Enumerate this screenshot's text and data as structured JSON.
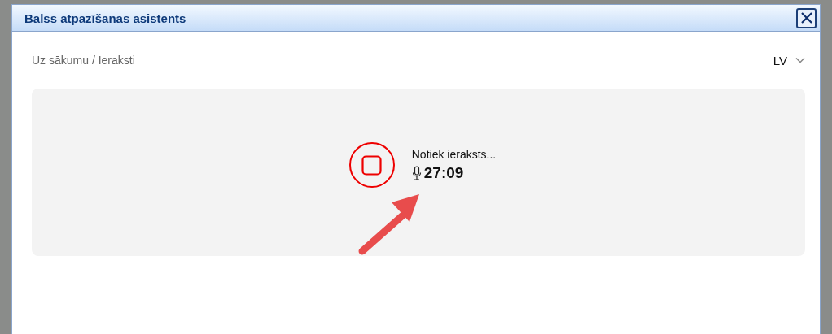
{
  "dialog": {
    "title": "Balss atpazīšanas asistents"
  },
  "breadcrumb": "Uz sākumu / Ieraksti",
  "language": {
    "value": "LV"
  },
  "recording": {
    "status": "Notiek ieraksts...",
    "time": "27:09"
  }
}
